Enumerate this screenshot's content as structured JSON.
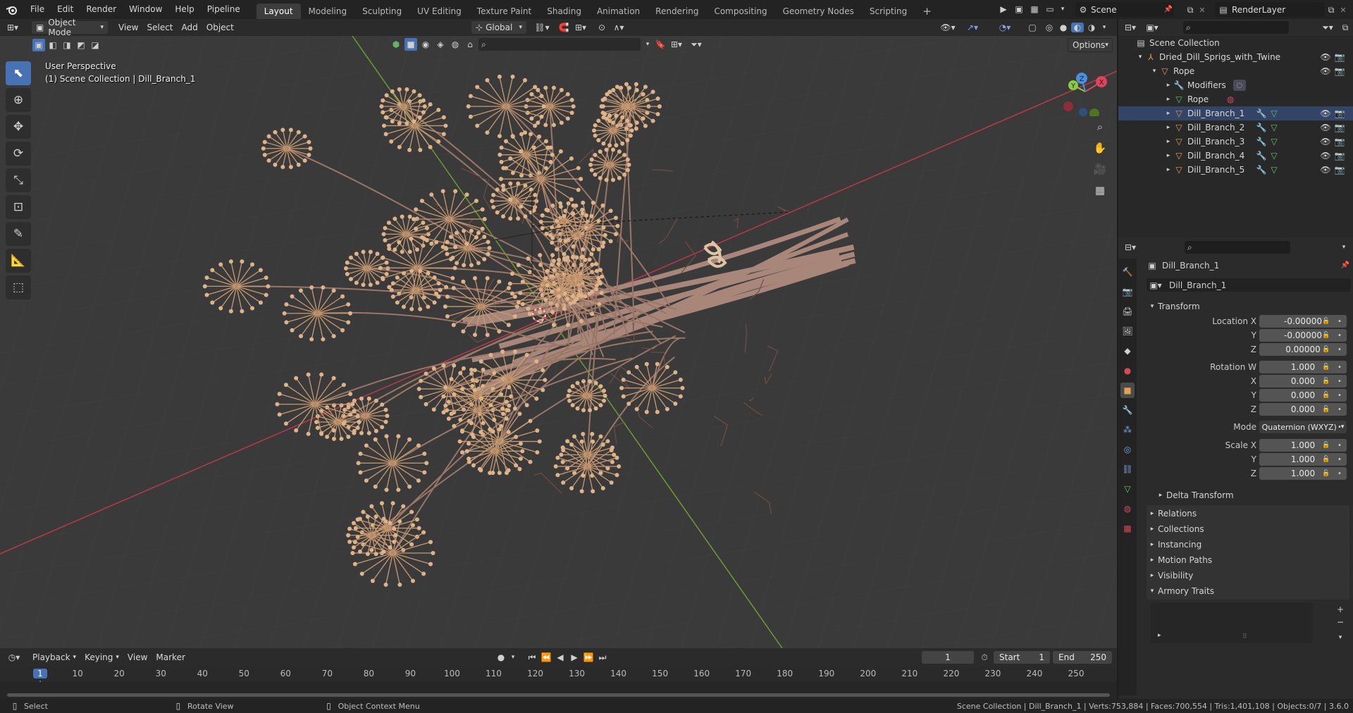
{
  "menu": [
    "File",
    "Edit",
    "Render",
    "Window",
    "Help",
    "Pipeline"
  ],
  "workspaces": [
    "Layout",
    "Modeling",
    "Sculpting",
    "UV Editing",
    "Texture Paint",
    "Shading",
    "Animation",
    "Rendering",
    "Compositing",
    "Geometry Nodes",
    "Scripting"
  ],
  "active_workspace": "Layout",
  "scene": "Scene",
  "view_layer": "RenderLayer",
  "viewport_header": {
    "mode": "Object Mode",
    "view": "View",
    "select": "Select",
    "add": "Add",
    "object": "Object",
    "orientation": "Global",
    "options": "Options"
  },
  "overlay_text": {
    "line1": "User Perspective",
    "line2": "(1) Scene Collection | Dill_Branch_1"
  },
  "gizmo": {
    "x": "X",
    "y": "Y",
    "z": "Z"
  },
  "outliner": {
    "root": "Scene Collection",
    "collection": "Dried_Dill_Sprigs_with_Twine",
    "rope": "Rope",
    "modifiers": "Modifiers",
    "rope_mesh": "Rope",
    "branches": [
      "Dill_Branch_1",
      "Dill_Branch_2",
      "Dill_Branch_3",
      "Dill_Branch_4",
      "Dill_Branch_5"
    ]
  },
  "properties": {
    "object_name": "Dill_Branch_1",
    "data_name": "Dill_Branch_1",
    "transform_title": "Transform",
    "location_x_label": "Location X",
    "y_label": "Y",
    "z_label": "Z",
    "location": [
      "-0.00000",
      "-0.00000",
      "0.00000"
    ],
    "rotation_w_label": "Rotation W",
    "x_label": "X",
    "rotation": [
      "1.000",
      "0.000",
      "0.000",
      "0.000"
    ],
    "mode_label": "Mode",
    "mode_value": "Quaternion (WXYZ)",
    "scale_x_label": "Scale X",
    "scale": [
      "1.000",
      "1.000",
      "1.000"
    ],
    "delta": "Delta Transform",
    "panels": [
      "Relations",
      "Collections",
      "Instancing",
      "Motion Paths",
      "Visibility"
    ],
    "armory": "Armory Traits"
  },
  "timeline": {
    "playback": "Playback",
    "keying": "Keying",
    "view": "View",
    "marker": "Marker",
    "current_frame": "1",
    "start_label": "Start",
    "start": "1",
    "end_label": "End",
    "end": "250",
    "ticks": [
      "1",
      "10",
      "20",
      "30",
      "40",
      "50",
      "60",
      "70",
      "80",
      "90",
      "100",
      "110",
      "120",
      "130",
      "140",
      "150",
      "160",
      "170",
      "180",
      "190",
      "200",
      "210",
      "220",
      "230",
      "240",
      "250"
    ]
  },
  "status": {
    "select": "Select",
    "rotate": "Rotate View",
    "context": "Object Context Menu",
    "info": "Scene Collection | Dill_Branch_1 | Verts:753,884 | Faces:700,554 | Tris:1,401,108 | Objects:0/7 | 3.6.0"
  },
  "colors": {
    "accent": "#4772b3",
    "x_axis": "#e0435a",
    "y_axis": "#8acd44",
    "z_axis": "#4a8fe0",
    "dill": "#c89a72",
    "stem": "#a8877a"
  }
}
